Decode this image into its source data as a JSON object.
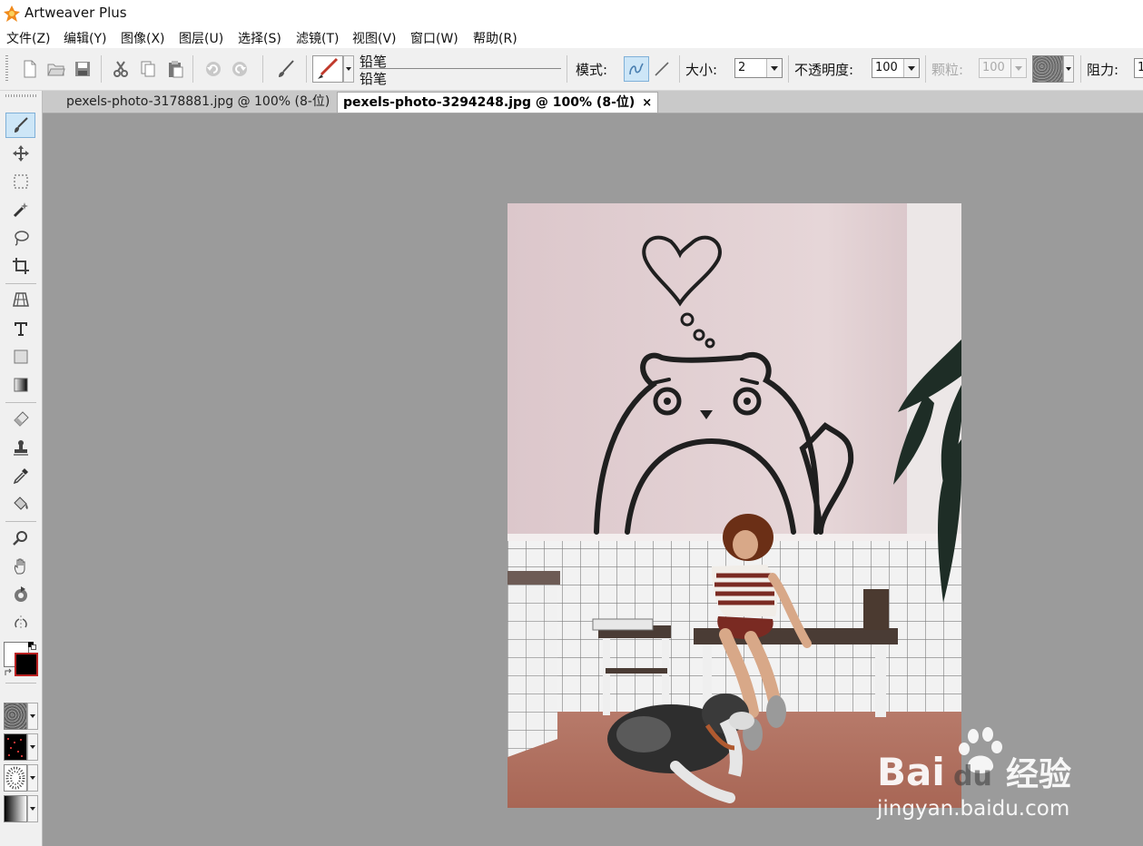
{
  "app": {
    "title": "Artweaver Plus",
    "icon": "artweaver-logo-icon"
  },
  "menu": [
    "文件(Z)",
    "编辑(Y)",
    "图像(X)",
    "图层(U)",
    "选择(S)",
    "滤镜(T)",
    "视图(V)",
    "窗口(W)",
    "帮助(R)"
  ],
  "toolbar": {
    "buttons": [
      "new-document-icon",
      "open-folder-icon",
      "save-icon",
      "cut-icon",
      "copy-icon",
      "paste-icon",
      "undo-icon",
      "redo-icon",
      "brush-icon"
    ],
    "preset_name_top": "铅笔",
    "preset_name_bottom": "铅笔",
    "mode_label": "模式:",
    "mode_buttons": [
      "freehand-stroke-icon",
      "line-stroke-icon"
    ],
    "size_label": "大小:",
    "size_value": "2",
    "opacity_label": "不透明度:",
    "opacity_value": "100",
    "grain_label": "颗粒:",
    "grain_value": "100",
    "resist_label": "阻力:",
    "resist_value": "1"
  },
  "tools": [
    "paintbrush-icon",
    "move-icon",
    "rectangle-select-icon",
    "magic-wand-icon",
    "lasso-icon",
    "crop-icon",
    "perspective-icon",
    "text-icon",
    "shape-icon",
    "gradient-icon",
    "eraser-icon",
    "clone-stamp-icon",
    "eyedropper-icon",
    "paint-bucket-icon",
    "zoom-icon",
    "hand-icon",
    "rotate-icon",
    "symmetry-icon"
  ],
  "colors": {
    "foreground": "#000000",
    "background": "#ffffff",
    "accent": "#cde6f7"
  },
  "tabs": [
    {
      "label": "pexels-photo-3178881.jpg @ 100% (8-位)",
      "active": false
    },
    {
      "label": "pexels-photo-3294248.jpg @ 100% (8-位)",
      "active": true
    }
  ],
  "tab_close": "×",
  "watermark": {
    "brand": "Bai",
    "brand_tail": "du",
    "cn": "经验",
    "url": "jingyan.baidu.com"
  }
}
